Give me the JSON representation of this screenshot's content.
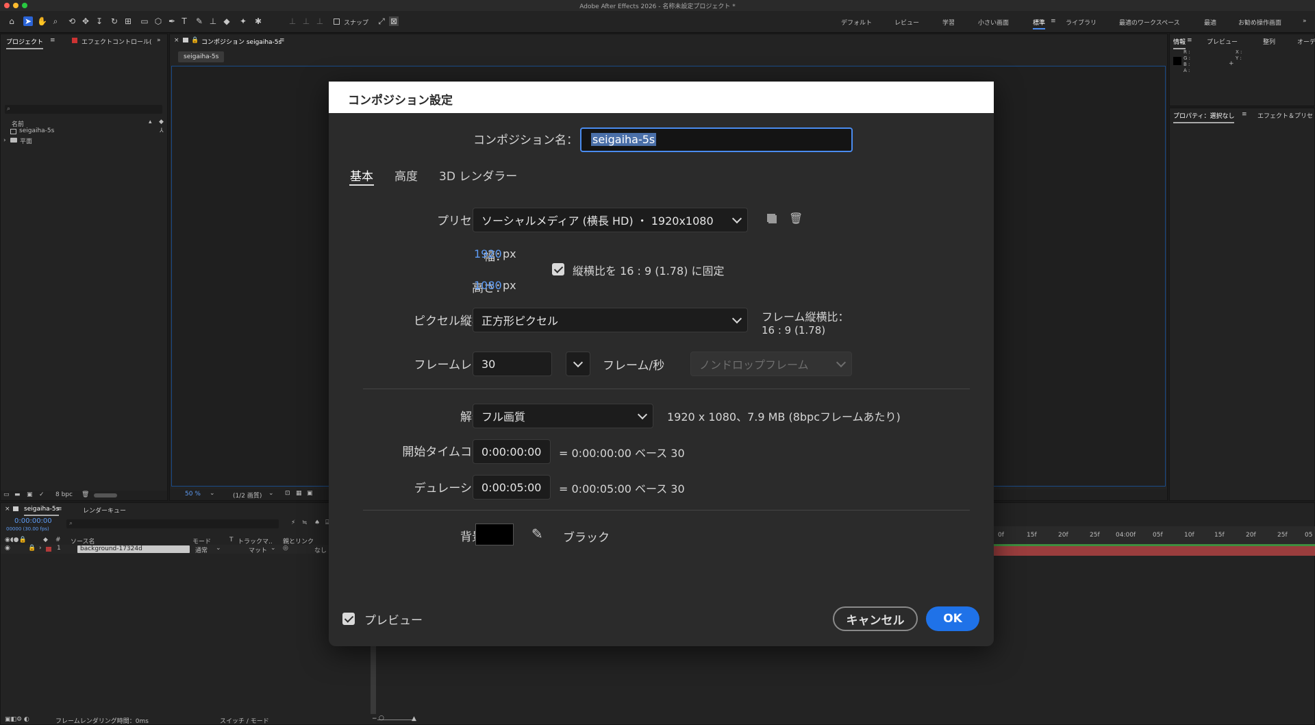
{
  "window": {
    "title": "Adobe After Effects 2026 - 名称未設定プロジェクト *"
  },
  "toolbar": {
    "snap_label": "スナップ",
    "workspaces": [
      "デフォルト",
      "レビュー",
      "学習",
      "小さい画面",
      "標準",
      "ライブラリ",
      "最適のワークスペース",
      "最適",
      "お勧め操作画面"
    ]
  },
  "project_panel": {
    "tabs": [
      "プロジェクト",
      "エフェクトコントロール("
    ],
    "search_placeholder": "",
    "column_name": "名前",
    "items": [
      "seigaiha-5s",
      "平面"
    ],
    "bpc": "8 bpc"
  },
  "comp_panel": {
    "tab": "コンポジション seigaiha-5s",
    "chip": "seigaiha-5s",
    "zoom": "50 %",
    "resolution": "(1/2 画質)"
  },
  "info_panel": {
    "tabs": [
      "情報",
      "プレビュー",
      "整列",
      "オーデ"
    ],
    "rgba": [
      "R :",
      "G :",
      "B :",
      "A :"
    ],
    "xy": [
      "X :",
      "Y :"
    ]
  },
  "properties_panel": {
    "tabs": [
      "プロパティ：選択なし",
      "エフェクト＆プリセ"
    ]
  },
  "timeline": {
    "tabs": [
      "seigaiha-5s",
      "レンダーキュー"
    ],
    "timecode": "0:00:00:00",
    "frame_info": "00000 (30.00 fps)",
    "columns": [
      "ソース名",
      "モード",
      "T",
      "トラックマ..",
      "親とリンク"
    ],
    "layer": {
      "index": "1",
      "name": "background-17324d",
      "mode": "通常",
      "matte": "マット",
      "parent": "なし"
    },
    "ruler": [
      "0f",
      "15f",
      "20f",
      "25f",
      "04:00f",
      "05f",
      "10f",
      "15f",
      "20f",
      "25f",
      "05"
    ],
    "footer_render": "フレームレンダリング時間：0ms",
    "footer_switch": "スイッチ / モード"
  },
  "dialog": {
    "title": "コンポジション設定",
    "name_label": "コンポジション名：",
    "name_value": "seigaiha-5s",
    "tabs": [
      "基本",
      "高度",
      "3D レンダラー"
    ],
    "preset_label": "プリセット：",
    "preset_value": "ソーシャルメディア (横長 HD) ・ 1920x1080 ・...",
    "width_label": "幅：",
    "width_value": "1920",
    "height_label": "高さ：",
    "height_value": "1080",
    "unit_px": "px",
    "lock_aspect_label": "縦横比を 16 : 9 (1.78) に固定",
    "lock_aspect_checked": true,
    "pixel_aspect_label": "ピクセル縦横比：",
    "pixel_aspect_value": "正方形ピクセル",
    "frame_aspect_label": "フレーム縦横比：",
    "frame_aspect_value": "16 : 9 (1.78)",
    "frame_rate_label": "フレームレート：",
    "frame_rate_value": "30",
    "frame_rate_unit": "フレーム/秒",
    "drop_frame_value": "ノンドロップフレーム",
    "resolution_label": "解像度：",
    "resolution_value": "フル画質",
    "resolution_info": "1920 x 1080、7.9 MB (8bpcフレームあたり)",
    "start_tc_label": "開始タイムコード：",
    "start_tc_value": "0:00:00:00",
    "start_tc_info": "= 0:00:00:00  ベース 30",
    "duration_label": "デュレーション：",
    "duration_value": "0:00:05:00",
    "duration_info": "= 0:00:05:00  ベース 30",
    "bg_label": "背景色：",
    "bg_color": "#000000",
    "bg_color_name": "ブラック",
    "preview_label": "プレビュー",
    "preview_checked": true,
    "cancel_label": "キャンセル",
    "ok_label": "OK"
  },
  "colors": {
    "accent": "#1f72e8",
    "value_blue": "#5e9cf5",
    "layer_red": "#b33a3a",
    "layer_green": "#3f8f3f"
  }
}
